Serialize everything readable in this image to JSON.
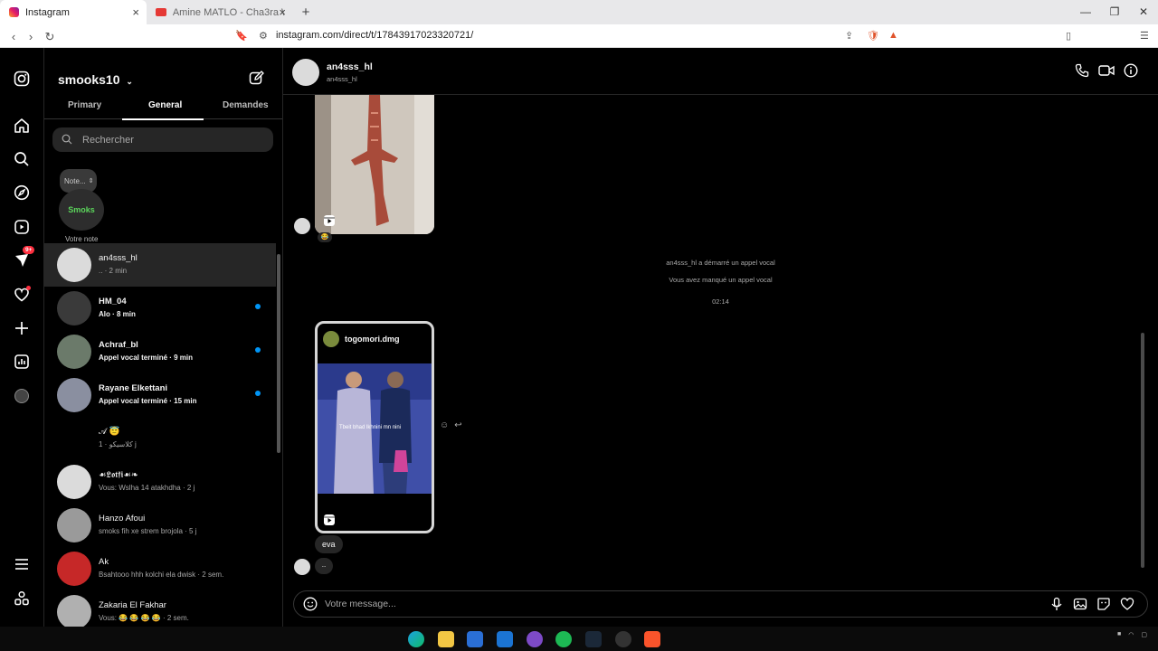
{
  "browser": {
    "tabs": [
      {
        "title": "Instagram",
        "active": true
      },
      {
        "title": "Amine MATLO - Cha3ra Wendir AVC",
        "active": false
      }
    ],
    "url": "instagram.com/direct/t/17843917023320721/"
  },
  "inbox": {
    "username": "smooks10",
    "tabs": [
      "Primary",
      "General",
      "Demandes"
    ],
    "selected_tab": "General",
    "search_placeholder": "Rechercher",
    "note_bubble": "Note...",
    "note_label": "Votre note",
    "note_avatar_text": "Smoks",
    "conversations": [
      {
        "name": "an4sss_hl",
        "preview": ".. · 2 min",
        "unread": false,
        "active": true
      },
      {
        "name": "HM_04",
        "preview": "Alo · 8 min",
        "unread": true,
        "active": false
      },
      {
        "name": "Achraf_bl",
        "preview": "Appel vocal terminé · 9 min",
        "unread": true,
        "active": false
      },
      {
        "name": "Rayane Elkettani",
        "preview": "Appel vocal terminé · 15 min",
        "unread": true,
        "active": false
      },
      {
        "name": "𝒜 😇",
        "preview": "كلاسيكو · 1 j",
        "unread": false,
        "active": false
      },
      {
        "name": "☙𝕷𝖔𝖙𝖋𝖎☙❧",
        "preview": "Vous: Wslha 14 atakhdha · 2 j",
        "unread": false,
        "active": false
      },
      {
        "name": "Hanzo Afoui",
        "preview": "smoks fih xe strem brojola · 5 j",
        "unread": false,
        "active": false
      },
      {
        "name": "Ak",
        "preview": "Bsahtooo hhh kolchi ela dwisk · 2 sem.",
        "unread": false,
        "active": false
      },
      {
        "name": "Zakaria El Fakhar",
        "preview": "Vous: 😂 😂 😂 😂 · 2 sem.",
        "unread": false,
        "active": false
      }
    ]
  },
  "chat": {
    "name": "an4sss_hl",
    "handle": "an4sss_hl",
    "reaction": "😂",
    "system_call": "an4sss_hl a démarré un appel vocal",
    "system_missed": "Vous avez manqué un appel vocal",
    "timestamp": "02:14",
    "reel_user": "togomori.dmg",
    "reel_caption": "Tbeit bhad lkhnini mn nini",
    "messages": [
      "eva",
      ".."
    ],
    "composer_placeholder": "Votre message..."
  },
  "rail": {
    "badge": "9+"
  }
}
